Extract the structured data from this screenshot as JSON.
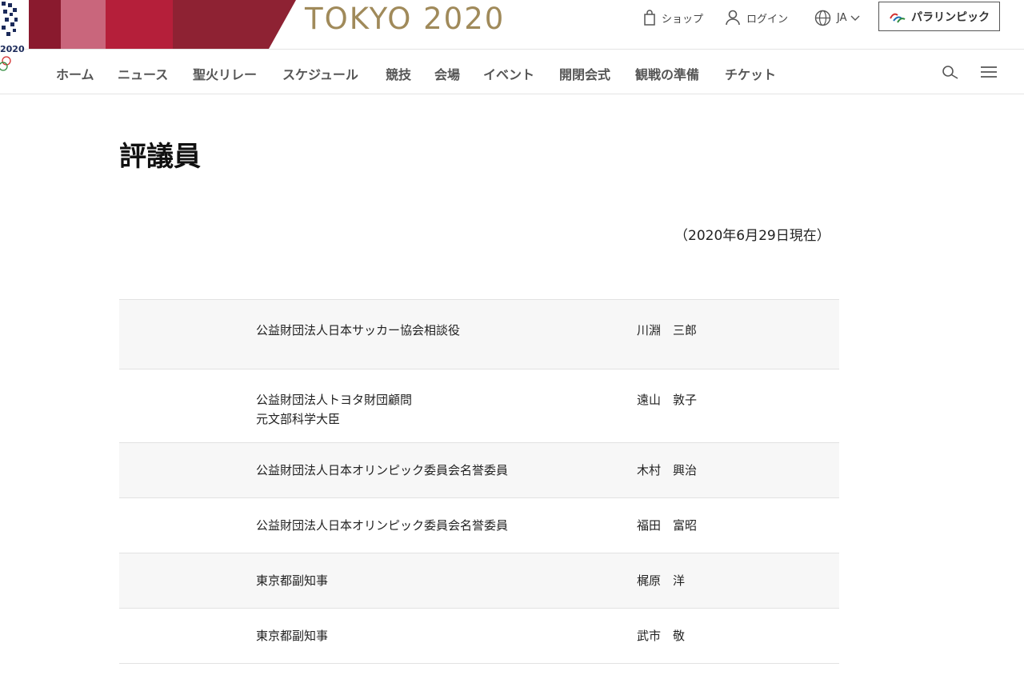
{
  "header": {
    "emblem_year": "2020",
    "logo_text": "TOKYO 2020",
    "shop_label": "ショップ",
    "login_label": "ログイン",
    "lang_label": "JA",
    "paralympic_label": "パラリンピック",
    "icons": [
      "shopping-bag-icon",
      "user-icon",
      "globe-icon",
      "chevron-down-icon",
      "paralympic-agitos-icon"
    ],
    "colors": {
      "logo_gold": "#a08a5a",
      "banner_red": "#b51f3a",
      "banner_dark_red": "#8a1a2e"
    }
  },
  "nav": {
    "items": [
      "ホーム",
      "ニュース",
      "聖火リレー",
      "スケジュール",
      "競技",
      "会場",
      "イベント",
      "開閉会式",
      "観戦の準備",
      "チケット"
    ],
    "icons": [
      "search-icon",
      "hamburger-menu-icon"
    ]
  },
  "main": {
    "title": "評議員",
    "as_of": "（2020年6月29日現在）",
    "rows": [
      {
        "org": [
          "公益財団法人日本サッカー協会相談役"
        ],
        "name": "川淵　三郎"
      },
      {
        "org": [
          "公益財団法人トヨタ財団顧問",
          "元文部科学大臣"
        ],
        "name": "遠山　敦子"
      },
      {
        "org": [
          "公益財団法人日本オリンピック委員会名誉委員"
        ],
        "name": "木村　興治"
      },
      {
        "org": [
          "公益財団法人日本オリンピック委員会名誉委員"
        ],
        "name": "福田　富昭"
      },
      {
        "org": [
          "東京都副知事"
        ],
        "name": "梶原　洋"
      },
      {
        "org": [
          "東京都副知事"
        ],
        "name": "武市　敬"
      }
    ]
  }
}
